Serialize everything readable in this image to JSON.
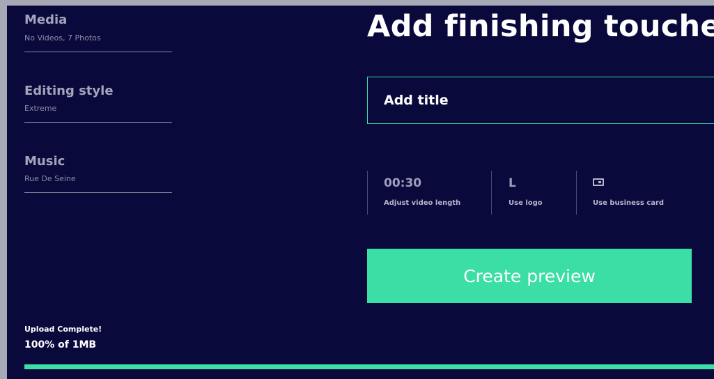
{
  "colors": {
    "background": "#0a093c",
    "accent": "#3bdfa6",
    "text_primary": "#ffffff",
    "text_muted": "#a3a5bd"
  },
  "sidebar": {
    "sections": [
      {
        "title": "Media",
        "subtitle": "No Videos, 7 Photos"
      },
      {
        "title": "Editing style",
        "subtitle": "Extreme"
      },
      {
        "title": "Music",
        "subtitle": "Rue De Seine"
      }
    ]
  },
  "main": {
    "heading": "Add finishing touches",
    "title_input": {
      "placeholder": "Add title",
      "value": ""
    },
    "options": [
      {
        "value": "00:30",
        "label": "Adjust video length"
      },
      {
        "value": "L",
        "label": "Use logo"
      },
      {
        "icon": "business-card-icon",
        "label": "Use business card"
      }
    ],
    "create_button": "Create preview"
  },
  "upload": {
    "status": "Upload Complete!",
    "progress_text": "100% of 1MB",
    "progress": 1.0
  }
}
